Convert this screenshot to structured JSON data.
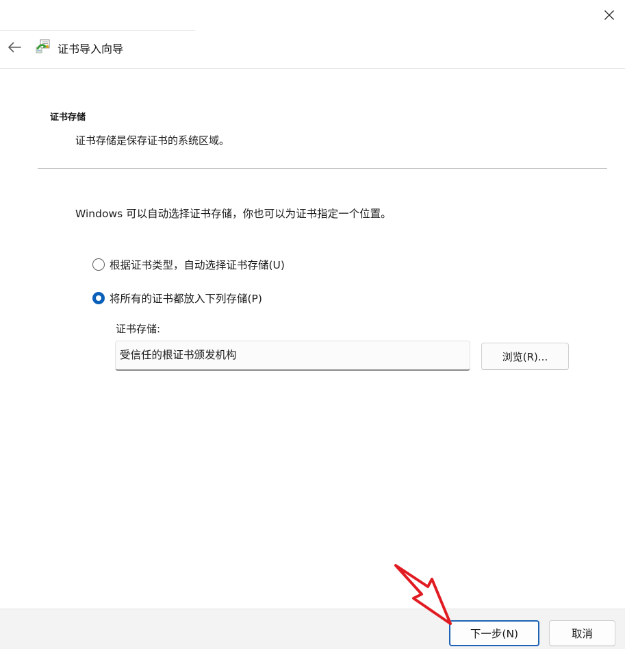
{
  "window": {
    "title": "证书导入向导",
    "back_icon": "arrow-left-icon",
    "close_icon": "close-icon",
    "wizard_icon": "certificate-wizard-icon"
  },
  "section": {
    "title": "证书存储",
    "description": "证书存储是保存证书的系统区域。"
  },
  "intro": "Windows 可以自动选择证书存储，你也可以为证书指定一个位置。",
  "options": [
    {
      "label": "根据证书类型，自动选择证书存储(U)",
      "checked": false
    },
    {
      "label": "将所有的证书都放入下列存储(P)",
      "checked": true
    }
  ],
  "store": {
    "label": "证书存储:",
    "value": "受信任的根证书颁发机构",
    "browse_label": "浏览(R)..."
  },
  "footer": {
    "next_label": "下一步(N)",
    "cancel_label": "取消"
  },
  "colors": {
    "accent": "#0a5fb8",
    "pointer_arrow": "#e11b22"
  }
}
